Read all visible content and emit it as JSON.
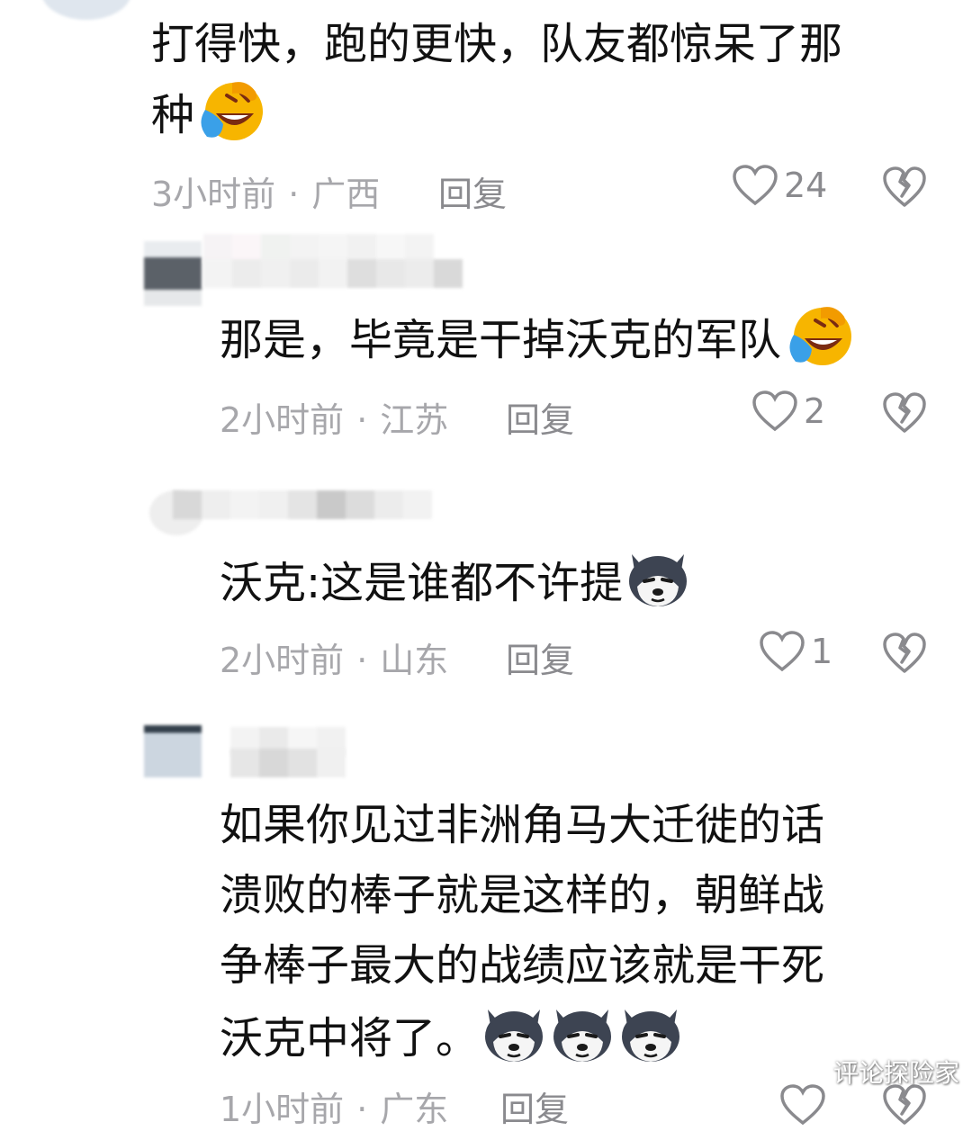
{
  "comments": [
    {
      "text_line1": "打得快，跑的更快，队友都惊呆了那",
      "text_line2": "种",
      "time": "3小时前",
      "location": "广西",
      "reply": "回复",
      "likes": "24",
      "emoji_icon": "laugh-cry-icon"
    },
    {
      "text_line1": "那是，毕竟是干掉沃克的军队",
      "time": "2小时前",
      "location": "江苏",
      "reply": "回复",
      "likes": "2",
      "emoji_icon": "laugh-cry-icon"
    },
    {
      "text_line1": "沃克:这是谁都不许提",
      "time": "2小时前",
      "location": "山东",
      "reply": "回复",
      "likes": "1",
      "emoji_icon": "husky-dog-icon"
    },
    {
      "text_line1": "如果你见过非洲角马大迁徙的话",
      "text_line2": "溃败的棒子就是这样的，朝鲜战",
      "text_line3": "争棒子最大的战绩应该就是干死",
      "text_line4": "沃克中将了。",
      "time": "1小时前",
      "location": "广东",
      "reply": "回复",
      "emoji_icon": "husky-dog-icon"
    }
  ],
  "watermark": "评论探险家",
  "colors": {
    "meta": "#a7a7ab",
    "text": "#111111"
  }
}
